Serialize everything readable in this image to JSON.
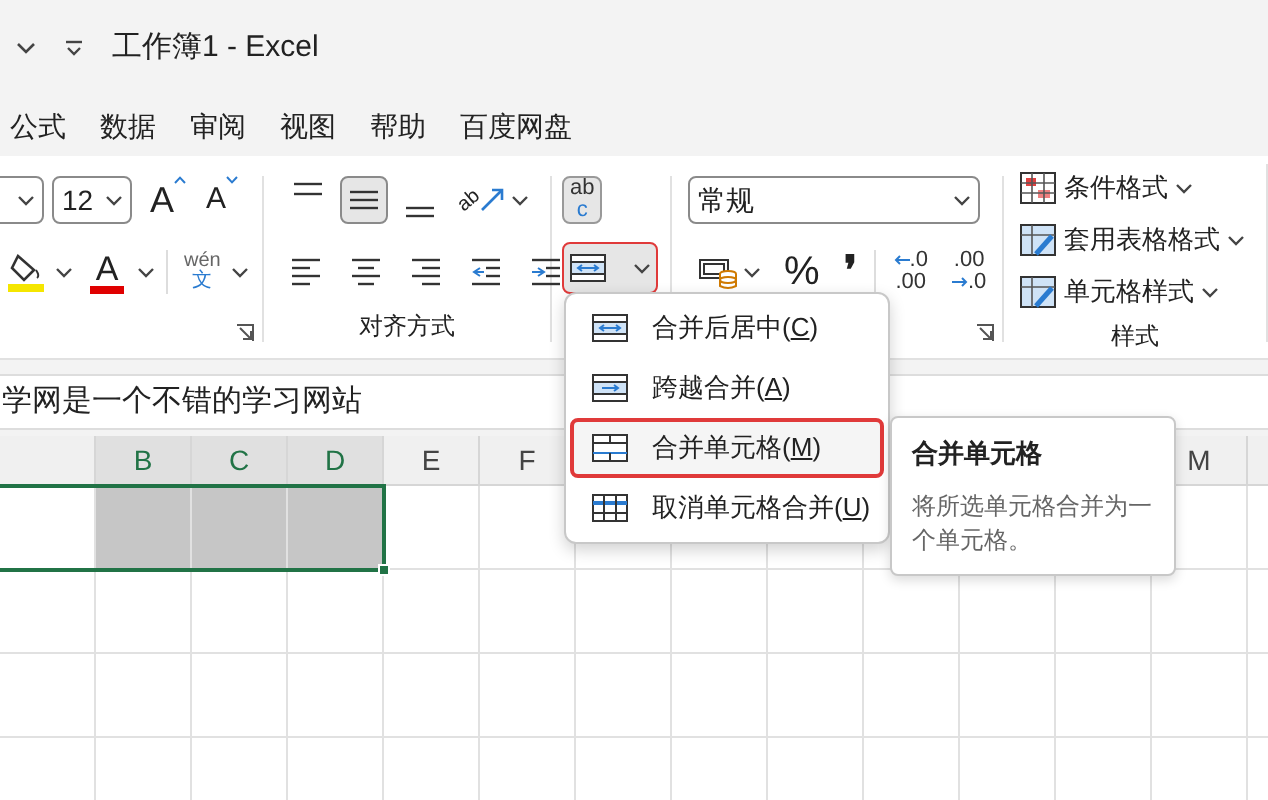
{
  "window": {
    "title": "工作簿1 - Excel"
  },
  "menu_tabs": [
    {
      "label": "公式"
    },
    {
      "label": "数据"
    },
    {
      "label": "审阅"
    },
    {
      "label": "视图"
    },
    {
      "label": "帮助"
    },
    {
      "label": "百度网盘"
    }
  ],
  "ribbon": {
    "font": {
      "size": "12",
      "grow": "A",
      "shrink": "A",
      "font_color": "A",
      "phonetic_top": "wén",
      "phonetic_bottom": "文"
    },
    "alignment": {
      "label": "对齐方式",
      "vertical": [
        {
          "kind": "top",
          "selected": false
        },
        {
          "kind": "middle",
          "selected": true
        },
        {
          "kind": "bottom",
          "selected": false
        }
      ],
      "horizontal": [
        {
          "kind": "left"
        },
        {
          "kind": "center"
        },
        {
          "kind": "right"
        },
        {
          "kind": "outdent"
        },
        {
          "kind": "indent"
        }
      ]
    },
    "orientation": {
      "text": "ab"
    },
    "wrap": {
      "top": "ab",
      "bottom": "c"
    },
    "merge": {
      "expanded": true
    },
    "number": {
      "format": "常规",
      "percent": "%",
      "comma": "❜",
      "increase_decimal": [
        ".0",
        ".00"
      ],
      "decrease_decimal": [
        ".00",
        ".0"
      ]
    },
    "styles": {
      "label": "样式",
      "items": [
        {
          "label": "条件格式",
          "kind": "conditional"
        },
        {
          "label": "套用表格格式",
          "kind": "table"
        },
        {
          "label": "单元格样式",
          "kind": "cell"
        }
      ]
    }
  },
  "formula_bar": {
    "value": "学网是一个不错的学习网站"
  },
  "sheet": {
    "columns": [
      {
        "label": "B",
        "selected": true
      },
      {
        "label": "C",
        "selected": true
      },
      {
        "label": "D",
        "selected": true
      },
      {
        "label": "E",
        "selected": false
      },
      {
        "label": "F",
        "selected": false
      },
      {
        "label": "M",
        "selected": false
      }
    ]
  },
  "merge_menu": {
    "items": [
      {
        "label": "合并后居中(",
        "access_key": "C",
        "suffix": ")",
        "kind": "center",
        "selected": false
      },
      {
        "label": "跨越合并(",
        "access_key": "A",
        "suffix": ")",
        "kind": "across",
        "selected": false
      },
      {
        "label": "合并单元格(",
        "access_key": "M",
        "suffix": ")",
        "kind": "merge",
        "selected": true
      },
      {
        "label": "取消单元格合并(",
        "access_key": "U",
        "suffix": ")",
        "kind": "unmerge",
        "selected": false
      }
    ]
  },
  "tooltip": {
    "title": "合并单元格",
    "text": "将所选单元格合并为一个单元格。"
  }
}
